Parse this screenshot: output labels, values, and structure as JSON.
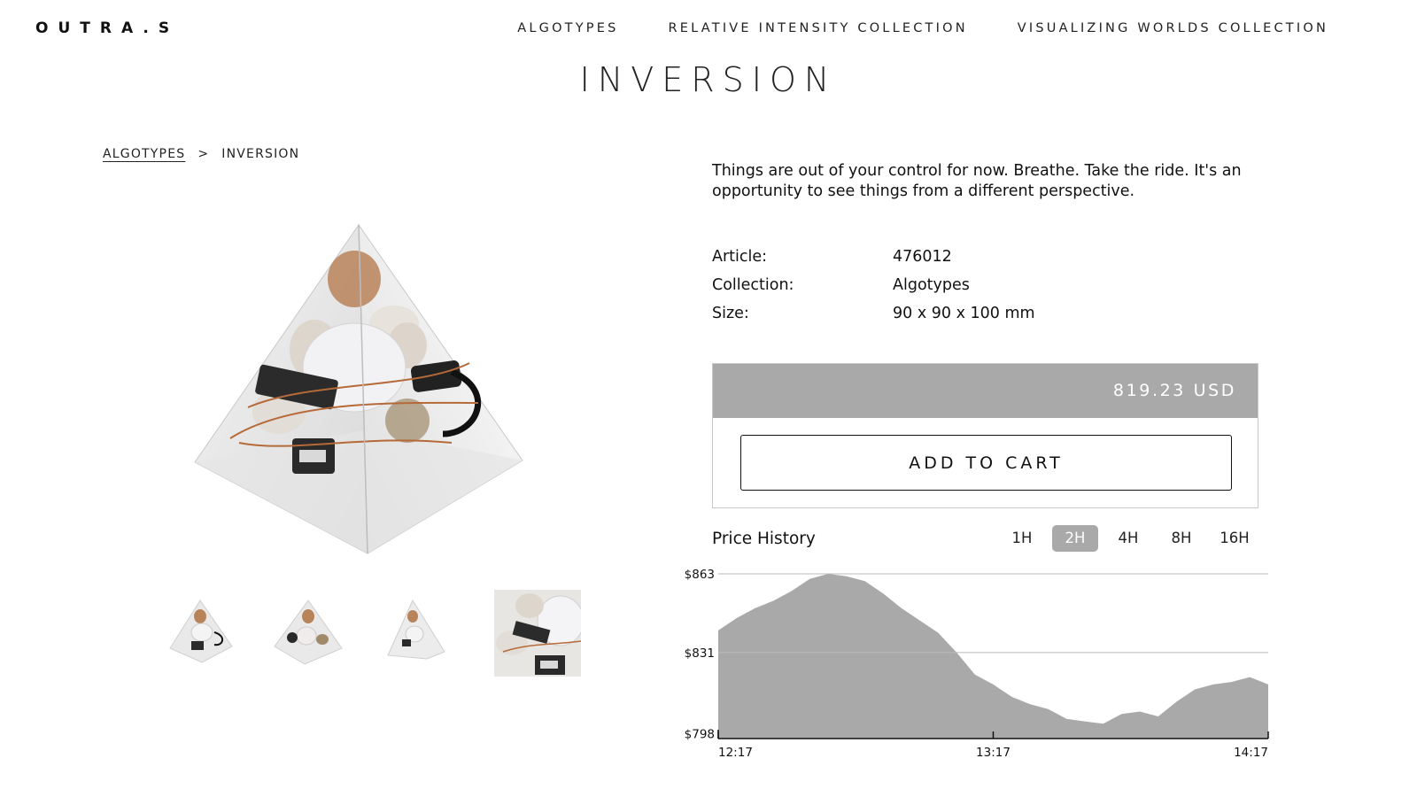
{
  "header": {
    "logo": "OUTRA.S",
    "nav": [
      "ALGOTYPES",
      "RELATIVE INTENSITY COLLECTION",
      "VISUALIZING WORLDS COLLECTION"
    ]
  },
  "page_title": "INVERSION",
  "breadcrumb": {
    "link": "ALGOTYPES",
    "separator": ">",
    "current": "INVERSION"
  },
  "product": {
    "description": "Things are out of your control for now. Breathe. Take the ride. It's an opportunity to see things from a different perspective.",
    "specs": [
      {
        "label": "Article:",
        "value": "476012"
      },
      {
        "label": "Collection:",
        "value": "Algotypes"
      },
      {
        "label": "Size:",
        "value": "90 x 90 x 100 mm"
      }
    ],
    "price": "819.23 USD",
    "add_to_cart": "ADD TO CART"
  },
  "price_history": {
    "title": "Price History",
    "ranges": [
      "1H",
      "2H",
      "4H",
      "8H",
      "16H"
    ],
    "active_range": "2H",
    "colors": {
      "fill": "#a9a9a9",
      "grid": "#bbbbbb",
      "axis": "#111111"
    }
  },
  "chart_data": {
    "type": "area",
    "y_tick_labels": [
      "$863",
      "$831",
      "$798"
    ],
    "x_tick_labels": [
      "12:17",
      "13:17",
      "14:17"
    ],
    "ylim": [
      796,
      863
    ],
    "x": [
      "12:17",
      "12:21",
      "12:25",
      "12:29",
      "12:33",
      "12:37",
      "12:41",
      "12:45",
      "12:49",
      "12:53",
      "12:57",
      "13:01",
      "13:05",
      "13:09",
      "13:13",
      "13:17",
      "13:21",
      "13:25",
      "13:29",
      "13:33",
      "13:37",
      "13:41",
      "13:45",
      "13:49",
      "13:53",
      "13:57",
      "14:01",
      "14:05",
      "14:09",
      "14:13",
      "14:17"
    ],
    "values": [
      840,
      845,
      849,
      852,
      856,
      861,
      863,
      862,
      860,
      855,
      849,
      844,
      839,
      831,
      822,
      818,
      813,
      810,
      808,
      804,
      803,
      802,
      806,
      807,
      805,
      811,
      816,
      818,
      819,
      821,
      818
    ]
  }
}
